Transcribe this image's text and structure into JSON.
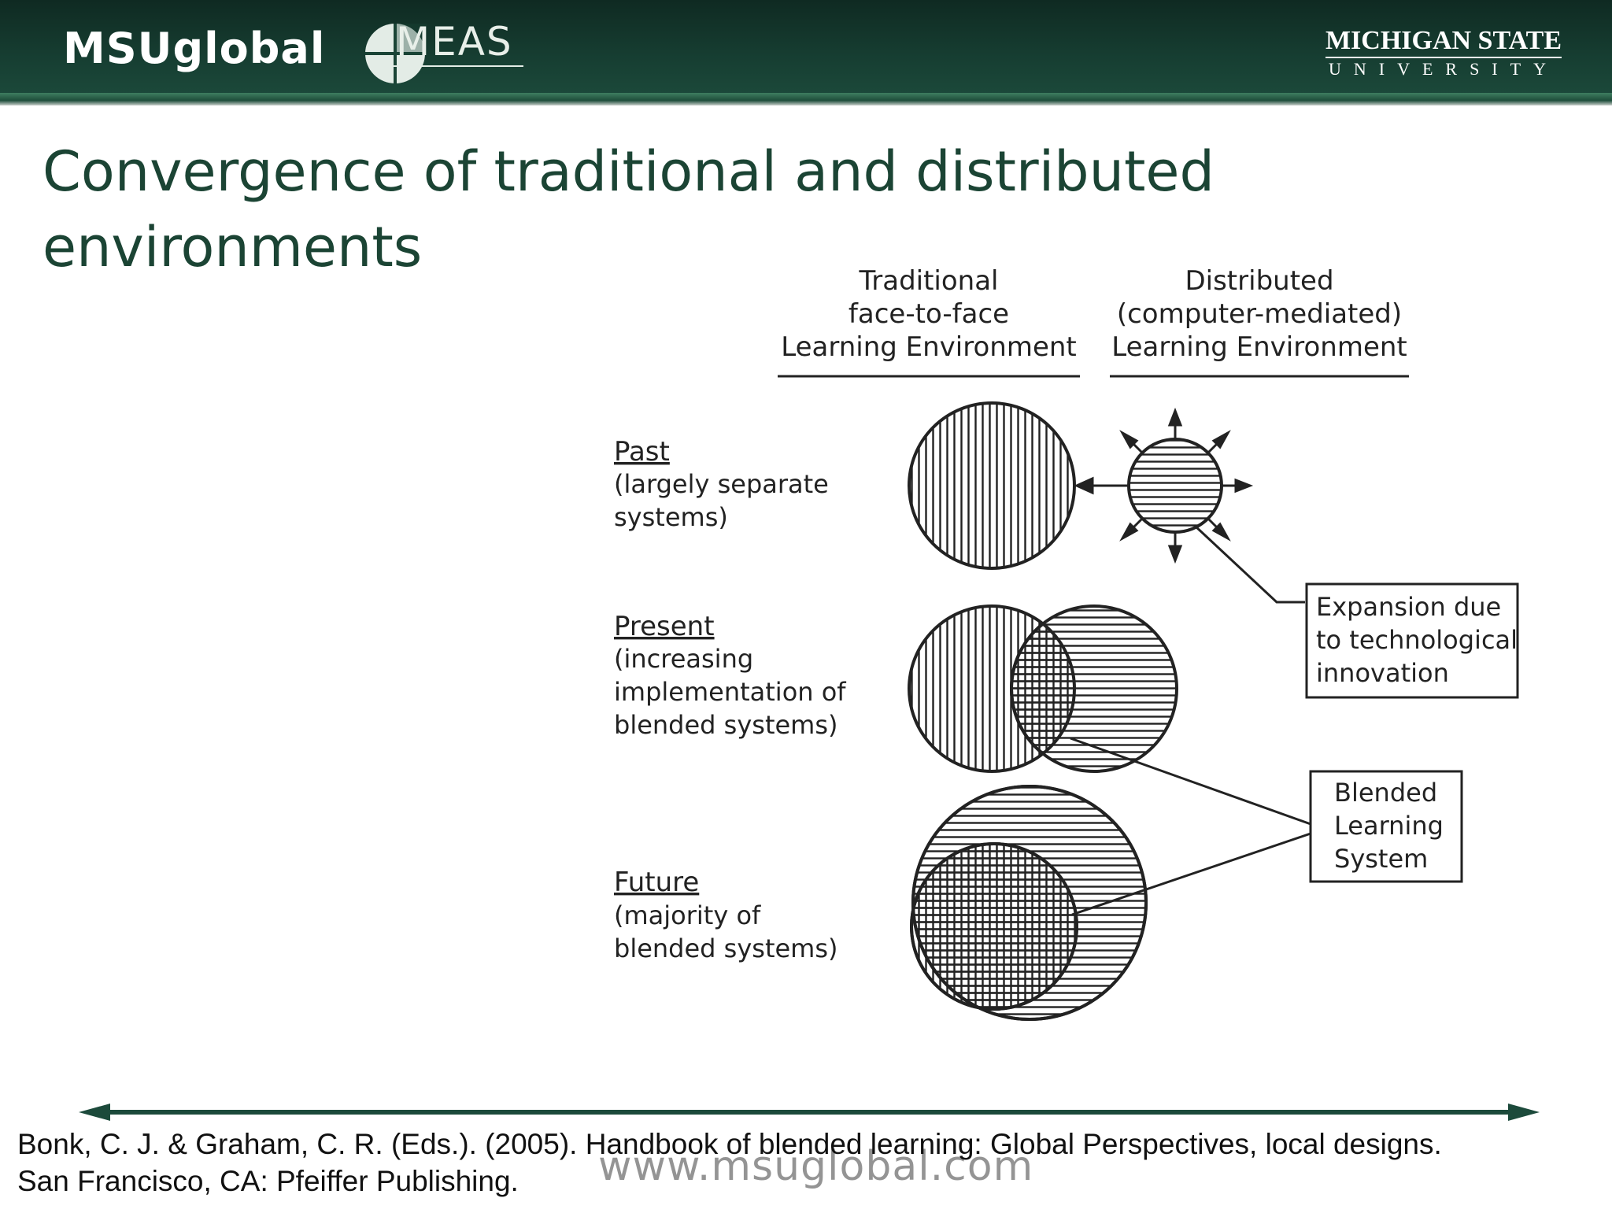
{
  "header": {
    "brand": "MSUglobal",
    "logo_text": "MEAS",
    "university_line1": "MICHIGAN STATE",
    "university_line2": "UNIVERSITY"
  },
  "slide": {
    "title_line1": "Convergence of traditional and distributed",
    "title_line2": "environments"
  },
  "diagram": {
    "columns": {
      "traditional": [
        "Traditional",
        "face-to-face",
        "Learning Environment"
      ],
      "distributed": [
        "Distributed",
        "(computer-mediated)",
        "Learning Environment"
      ]
    },
    "rows": {
      "past": {
        "title": "Past",
        "desc": [
          "(largely separate",
          "systems)"
        ]
      },
      "present": {
        "title": "Present",
        "desc": [
          "(increasing",
          "implementation of",
          "blended systems)"
        ]
      },
      "future": {
        "title": "Future",
        "desc": [
          "(majority of",
          "blended systems)"
        ]
      }
    },
    "callouts": {
      "expansion": [
        "Expansion due",
        "to technological",
        "innovation"
      ],
      "blended": [
        "Blended",
        "Learning",
        "System"
      ]
    }
  },
  "citation": {
    "line1": "Bonk, C. J. & Graham, C. R. (Eds.). (2005). Handbook of blended learning: Global Perspectives, local designs.",
    "line2": "San Francisco, CA: Pfeiffer Publishing."
  },
  "watermark": "www.msuglobal.com"
}
